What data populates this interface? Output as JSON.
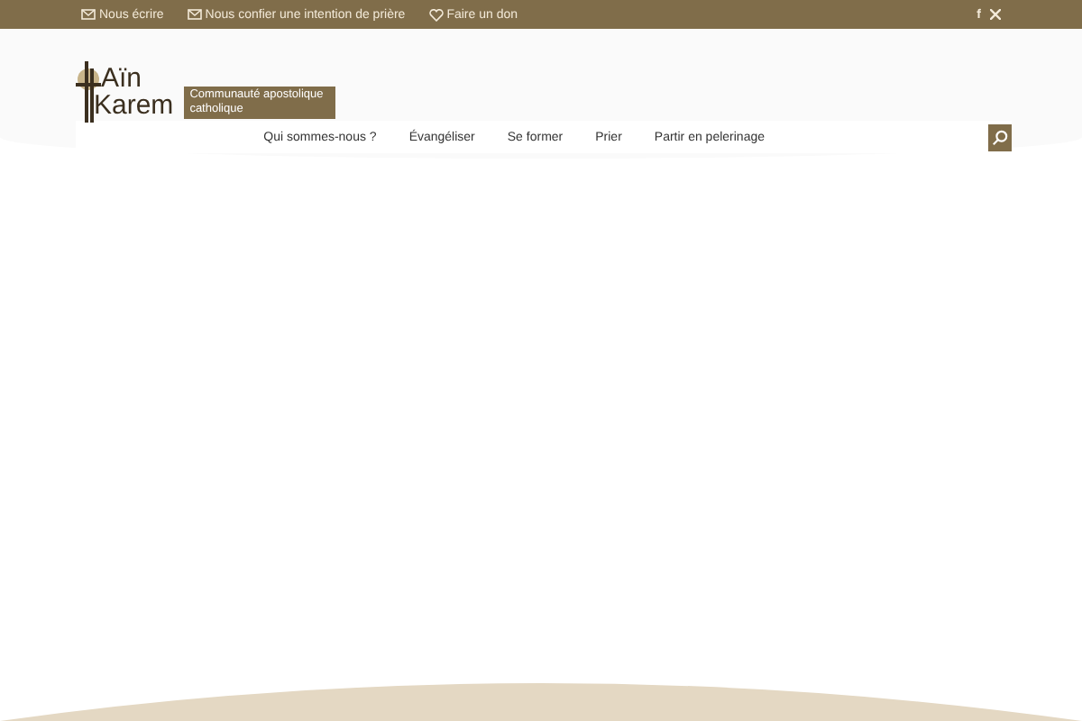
{
  "topbar": {
    "links": [
      {
        "kind": "mail",
        "label": "Nous écrire"
      },
      {
        "kind": "mail",
        "label": "Nous confier une intention de prière"
      },
      {
        "kind": "heart",
        "label": "Faire un don"
      }
    ],
    "social": [
      "f"
    ]
  },
  "logo": {
    "line1": "Aïn",
    "line2": "Karem",
    "tagline": "Communauté apostolique catholique"
  },
  "nav": [
    "Qui sommes-nous ?",
    "Évangéliser",
    "Se former",
    "Prier",
    "Partir en pelerinage"
  ]
}
